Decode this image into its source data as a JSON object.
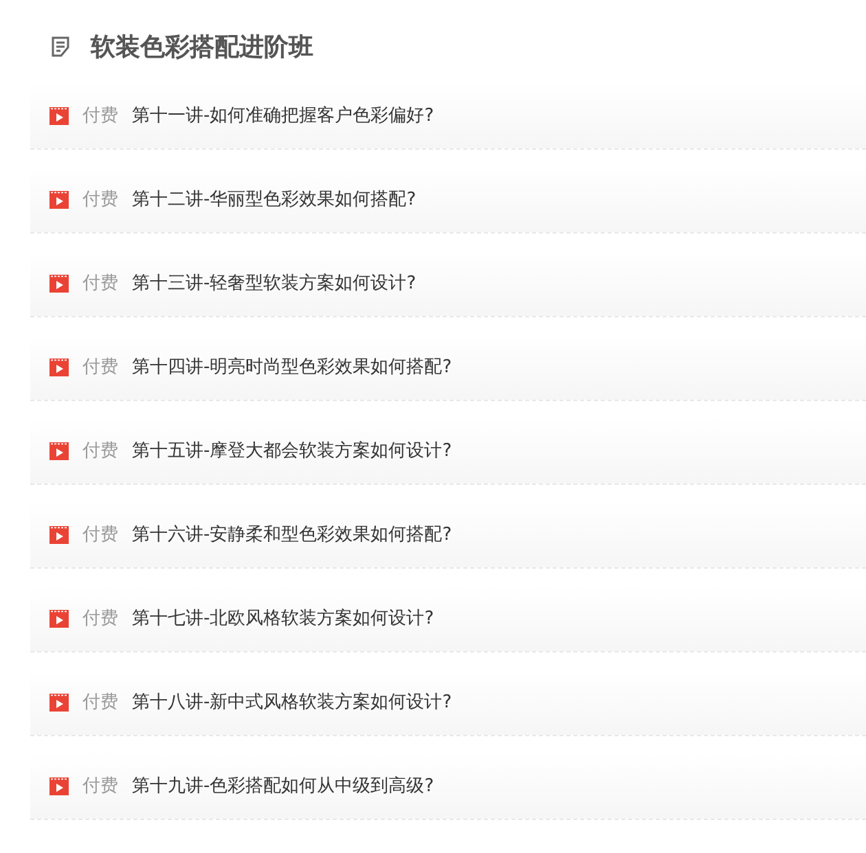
{
  "course": {
    "title": "软装色彩搭配进阶班"
  },
  "lessons": [
    {
      "tag": "付费",
      "title": "第十一讲-如何准确把握客户色彩偏好?"
    },
    {
      "tag": "付费",
      "title": "第十二讲-华丽型色彩效果如何搭配?"
    },
    {
      "tag": "付费",
      "title": "第十三讲-轻奢型软装方案如何设计?"
    },
    {
      "tag": "付费",
      "title": "第十四讲-明亮时尚型色彩效果如何搭配?"
    },
    {
      "tag": "付费",
      "title": "第十五讲-摩登大都会软装方案如何设计?"
    },
    {
      "tag": "付费",
      "title": "第十六讲-安静柔和型色彩效果如何搭配?"
    },
    {
      "tag": "付费",
      "title": "第十七讲-北欧风格软装方案如何设计?"
    },
    {
      "tag": "付费",
      "title": "第十八讲-新中式风格软装方案如何设计?"
    },
    {
      "tag": "付费",
      "title": "第十九讲-色彩搭配如何从中级到高级?"
    }
  ]
}
